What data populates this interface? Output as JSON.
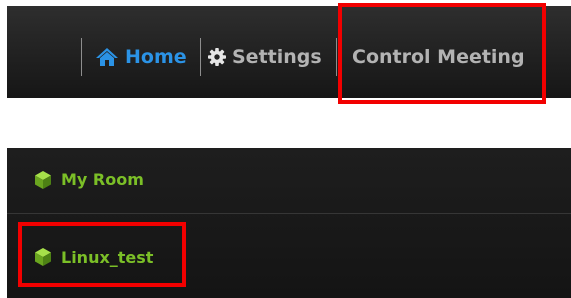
{
  "navbar": {
    "items": [
      {
        "label": "Home",
        "icon": "home-icon",
        "color": "#2b93e6",
        "active": true
      },
      {
        "label": "Settings",
        "icon": "gear-icon",
        "color": "#b3b3b3",
        "active": false
      },
      {
        "label": "Control Meeting",
        "icon": "",
        "color": "#b3b3b3",
        "active": false
      }
    ]
  },
  "rooms": {
    "items": [
      {
        "label": "My Room",
        "icon": "room-cube-icon",
        "color": "#7bbf27"
      },
      {
        "label": "Linux_test",
        "icon": "room-cube-icon",
        "color": "#7bbf27"
      }
    ]
  },
  "highlights": {
    "color": "#f20000",
    "targets": [
      "Control Meeting",
      "Linux_test"
    ]
  }
}
